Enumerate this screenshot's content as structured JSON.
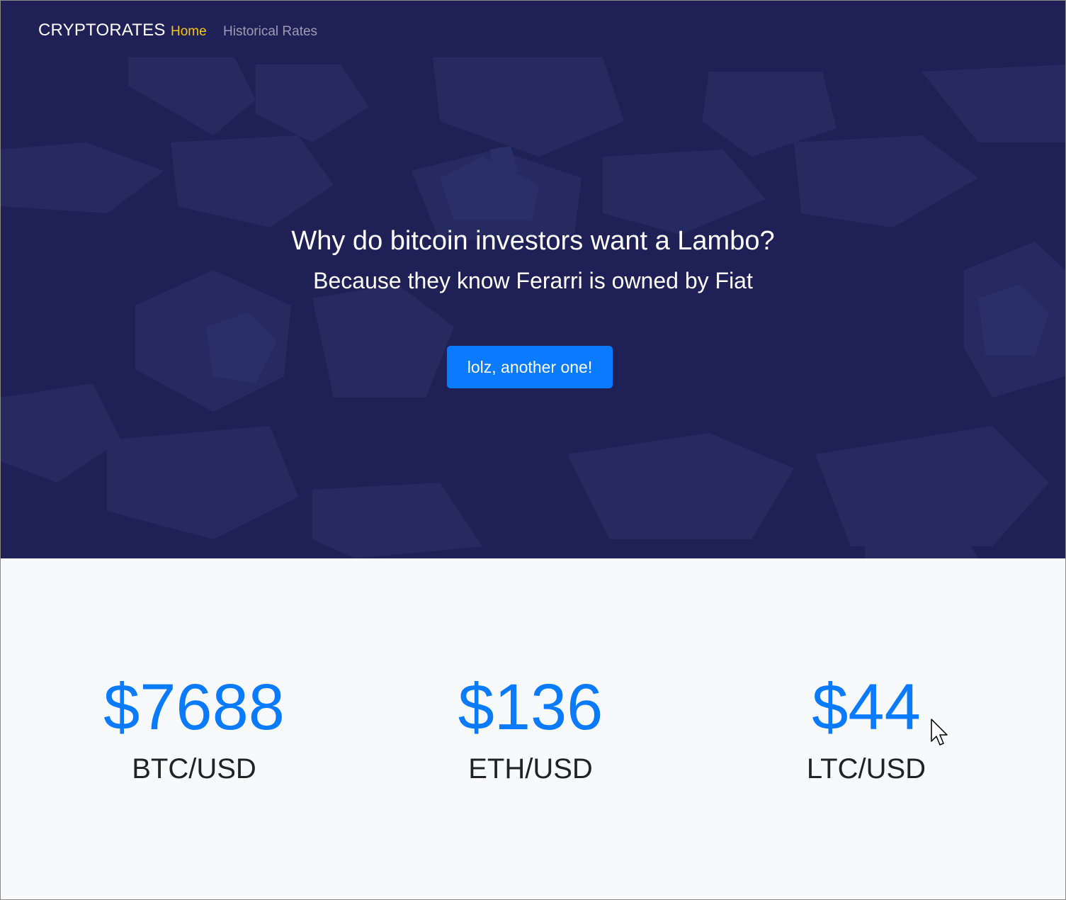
{
  "nav": {
    "brand": "CRYPTORATES",
    "links": [
      {
        "label": "Home",
        "active": true
      },
      {
        "label": "Historical Rates",
        "active": false
      }
    ]
  },
  "hero": {
    "question": "Why do bitcoin investors want a Lambo?",
    "answer": "Because they know Ferarri is owned by Fiat",
    "button_label": "lolz, another one!"
  },
  "rates": [
    {
      "price": "$7688",
      "pair": "BTC/USD"
    },
    {
      "price": "$136",
      "pair": "ETH/USD"
    },
    {
      "price": "$44",
      "pair": "LTC/USD"
    }
  ],
  "colors": {
    "hero_background": "#1f2156",
    "accent_blue": "#0a7bff",
    "active_nav": "#f5c518",
    "inactive_nav": "#9a9cb3",
    "page_background": "#f8f9fa"
  },
  "icons": [
    "mouse-pointer-icon"
  ]
}
